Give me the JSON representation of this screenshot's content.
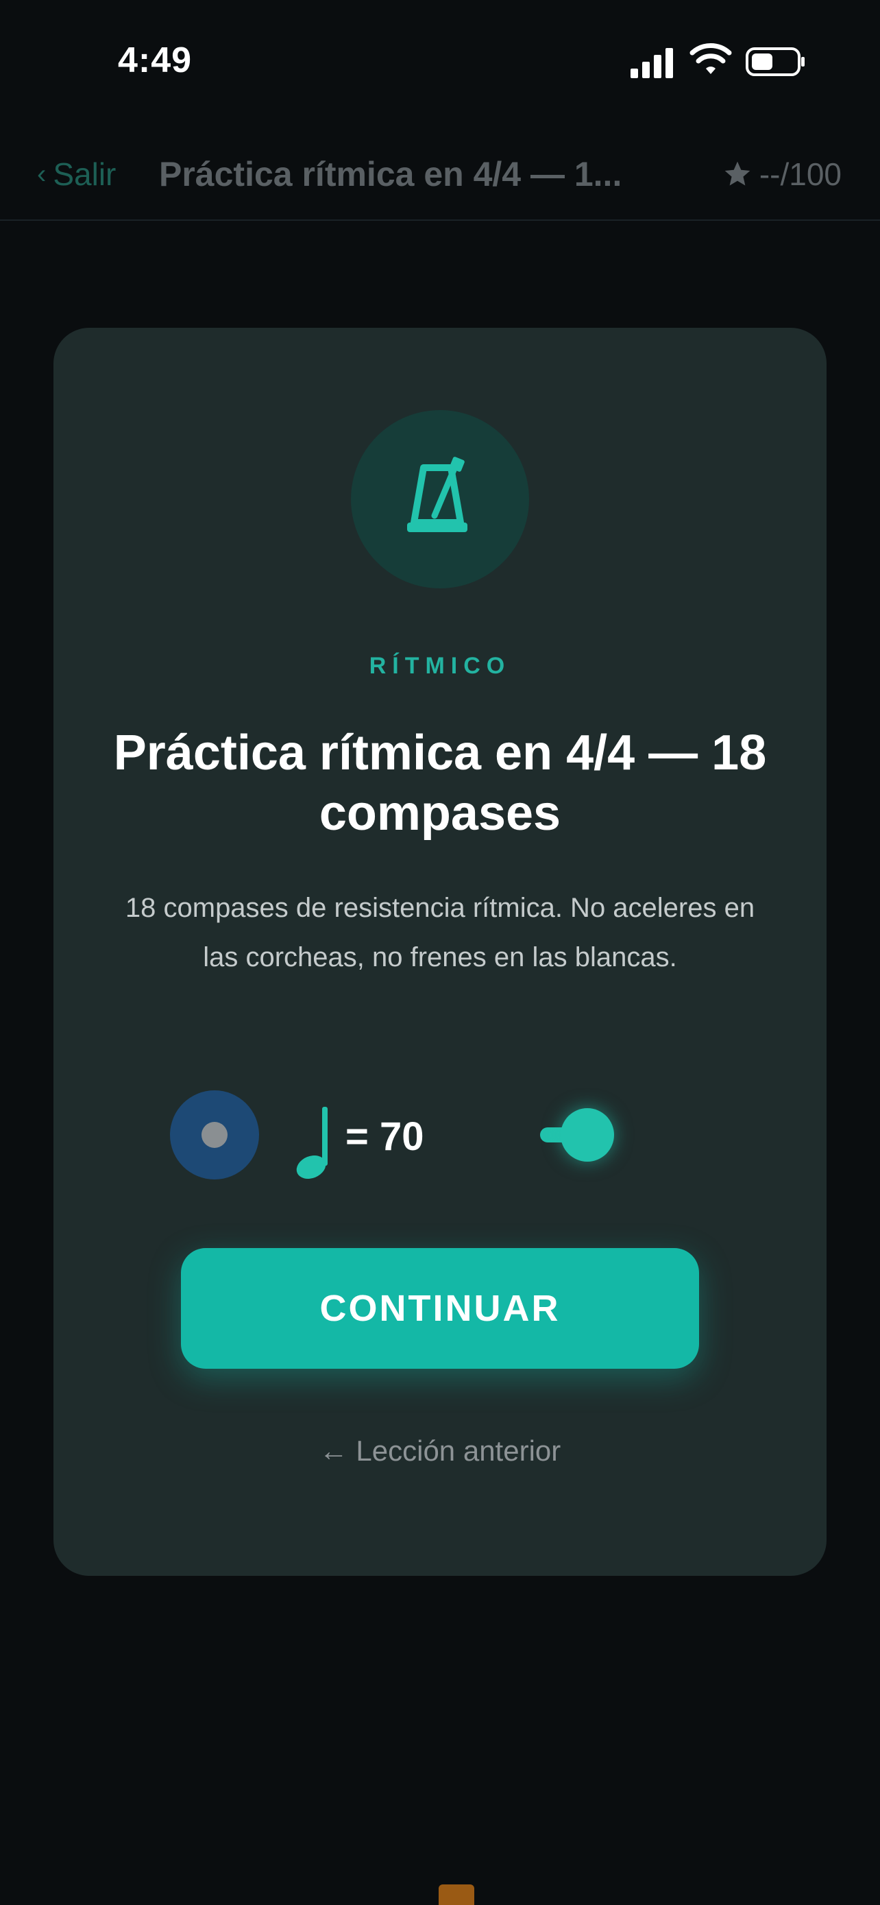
{
  "status_bar": {
    "time": "4:49"
  },
  "header": {
    "back_label": "Salir",
    "title": "Práctica rítmica en 4/4 — 1...",
    "score": "--/100"
  },
  "card": {
    "category": "RÍTMICO",
    "title": "Práctica rítmica en 4/4 — 18 compases",
    "description": "18 compases de resistencia rítmica. No aceleres en las corcheas, no frenes en las blancas.",
    "tempo": "= 70",
    "continue_label": "CONTINUAR",
    "previous_label": "← Lección anterior"
  },
  "colors": {
    "background": "#0a0d0f",
    "card": "#1f2c2c",
    "accent": "#14b8a6",
    "accent_text": "#23b3a1",
    "record_toggle": "#1d4975"
  },
  "icons": {
    "back": "chevron-left-icon",
    "score": "star-icon",
    "category": "metronome-icon",
    "tempo": "quarter-note-icon",
    "record": "record-icon",
    "metronome": "metronome-toggle-icon"
  }
}
